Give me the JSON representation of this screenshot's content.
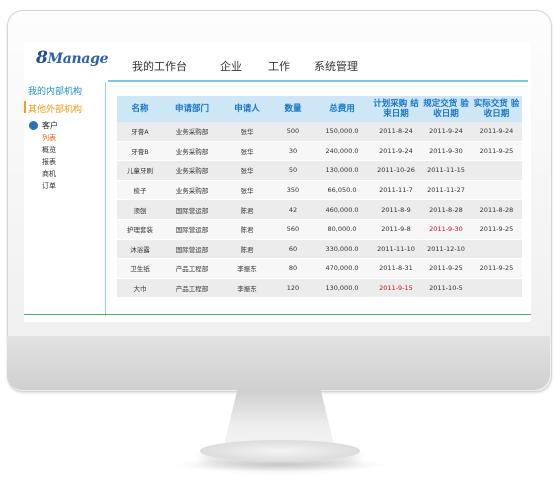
{
  "app": {
    "logo_number": "8",
    "logo_text": "Manage"
  },
  "topnav": [
    {
      "label": "我的工作台"
    },
    {
      "label": "企业"
    },
    {
      "label": "工作"
    },
    {
      "label": "系统管理"
    }
  ],
  "sidebar": {
    "links": [
      {
        "label": "我的内部机构"
      },
      {
        "label": "其他外部机构"
      }
    ],
    "customer": {
      "label": "客户",
      "icon": "user-icon",
      "items": [
        {
          "label": "列表"
        },
        {
          "label": "概览"
        },
        {
          "label": "报表"
        },
        {
          "label": "商机"
        },
        {
          "label": "订单"
        }
      ]
    }
  },
  "table": {
    "headers": [
      "名称",
      "申请部门",
      "申请人",
      "数量",
      "总费用",
      "计划采购 结束日期",
      "规定交货 验收日期",
      "实际交货 验收日期"
    ],
    "rows": [
      [
        "牙膏A",
        "业务采购部",
        "张华",
        "500",
        "150,000.0",
        "2011-8-24",
        "2011-9-24",
        "2011-9-24"
      ],
      [
        "牙膏B",
        "业务采购部",
        "张华",
        "30",
        "240,000.0",
        "2011-9-24",
        "2011-9-30",
        "2011-9-25"
      ],
      [
        "儿童牙刷",
        "业务采购部",
        "张华",
        "50",
        "130,000.0",
        "2011-10-26",
        "2011-11-15",
        ""
      ],
      [
        "梳子",
        "业务采购部",
        "张华",
        "350",
        "66,050.0",
        "2011-11-7",
        "2011-11-27",
        ""
      ],
      [
        "须刨",
        "国际营运部",
        "陈君",
        "42",
        "460,000.0",
        "2011-8-9",
        "2011-8-28",
        "2011-8-28"
      ],
      [
        "护理套装",
        "国际营运部",
        "陈君",
        "560",
        "80,000.0",
        "2011-9-8",
        "2011-9-30",
        "2011-9-25"
      ],
      [
        "沐浴露",
        "国际营运部",
        "陈君",
        "60",
        "330,000.0",
        "2011-11-10",
        "2011-12-10",
        ""
      ],
      [
        "卫生纸",
        "产品工程部",
        "李振东",
        "80",
        "470,000.0",
        "2011-8-31",
        "2011-9-25",
        "2011-9-25"
      ],
      [
        "大巾",
        "产品工程部",
        "李振东",
        "120",
        "130,000.0",
        "2011-9-15",
        "2011-10-5",
        ""
      ]
    ],
    "red_cells": [
      [
        5,
        6
      ],
      [
        8,
        5
      ]
    ],
    "red_color": "#c0141d",
    "header_bg": "#cde7f7",
    "header_color": "#1b74c6"
  }
}
